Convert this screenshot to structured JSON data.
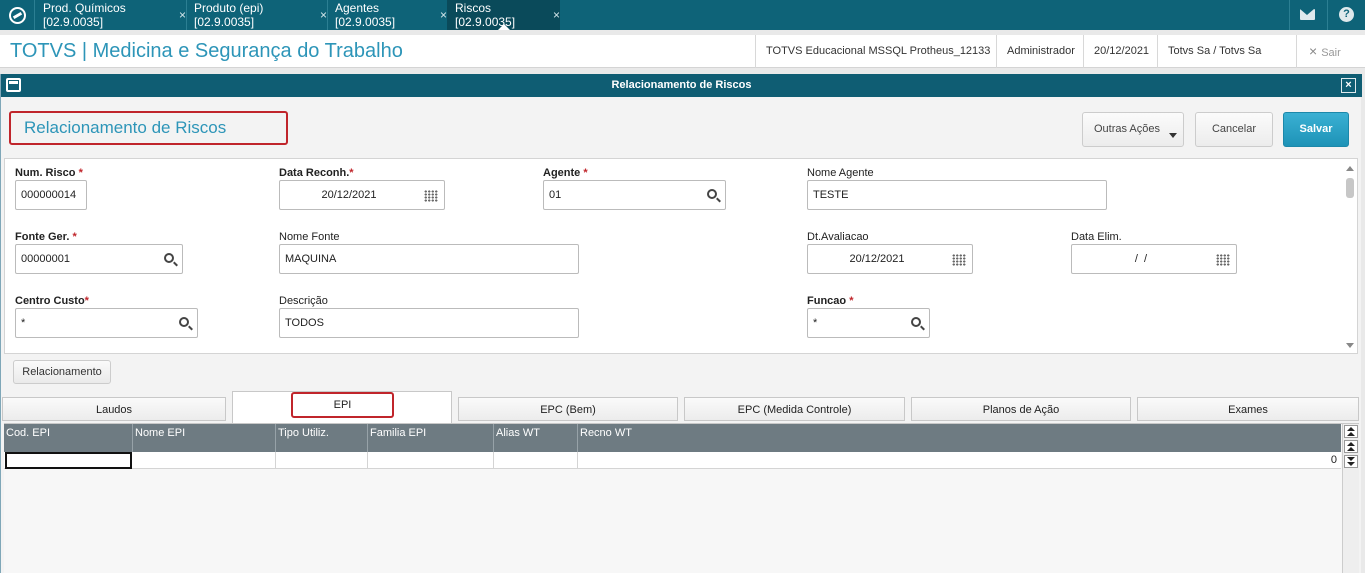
{
  "tabs": [
    {
      "label": "Prod. Químicos [02.9.0035]"
    },
    {
      "label": "Produto (epi) [02.9.0035]"
    },
    {
      "label": "Agentes [02.9.0035]"
    },
    {
      "label": "Riscos [02.9.0035]"
    }
  ],
  "tab_close": "×",
  "header": {
    "title": "TOTVS | Medicina e Segurança do Trabalho",
    "environment": "TOTVS Educacional MSSQL Protheus_12133",
    "user": "Administrador",
    "date": "20/12/2021",
    "company": "Totvs Sa / Totvs Sa",
    "exit_label": "Sair",
    "exit_icon": "×"
  },
  "dialog": {
    "title": "Relacionamento de Riscos",
    "close_icon": "×",
    "page_title": "Relacionamento de Riscos",
    "actions": {
      "more": "Outras Ações",
      "cancel": "Cancelar",
      "save": "Salvar"
    }
  },
  "required_mark": "*",
  "form": {
    "num_risco": {
      "label": "Num. Risco",
      "value": "000000014"
    },
    "data_reconh": {
      "label": "Data Reconh.",
      "value": "20/12/2021"
    },
    "agente": {
      "label": "Agente",
      "value": "01"
    },
    "nome_agente": {
      "label": "Nome Agente",
      "value": "TESTE"
    },
    "fonte_ger": {
      "label": "Fonte Ger.",
      "value": "00000001"
    },
    "nome_fonte": {
      "label": "Nome Fonte",
      "value": "MAQUINA"
    },
    "dt_avaliacao": {
      "label": "Dt.Avaliacao",
      "value": "20/12/2021"
    },
    "data_elim": {
      "label": "Data Elim.",
      "value": "/  /"
    },
    "centro_custo": {
      "label": "Centro Custo",
      "value": "*"
    },
    "descricao": {
      "label": "Descrição",
      "value": "TODOS"
    },
    "funcao": {
      "label": "Funcao",
      "value": "*"
    }
  },
  "relacionamento_button": "Relacionamento",
  "folder_tabs": [
    "Laudos",
    "EPI",
    "EPC (Bem)",
    "EPC (Medida Controle)",
    "Planos de Ação",
    "Exames"
  ],
  "grid": {
    "columns": [
      "Cod. EPI",
      "Nome EPI",
      "Tipo Utiliz.",
      "Familia EPI",
      "Alias WT",
      "Recno WT"
    ],
    "rows": [
      [
        "",
        "",
        "",
        "",
        "",
        "0"
      ]
    ]
  }
}
